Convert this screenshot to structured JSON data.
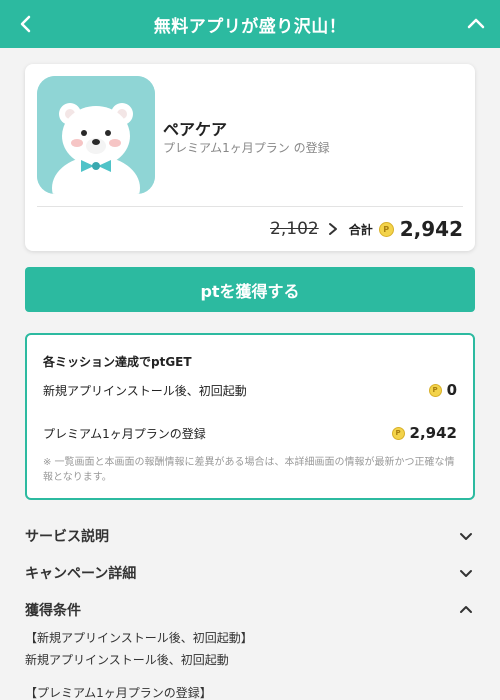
{
  "header": {
    "title": "無料アプリが盛り沢山！"
  },
  "app": {
    "name": "ペアケア",
    "description": "プレミアム1ヶ月プラン の登録",
    "old_price": "2,102",
    "total_label": "合計",
    "total_value": "2,942",
    "coin_symbol": "P"
  },
  "get_button": {
    "label": "ptを獲得する"
  },
  "missions": {
    "title": "各ミッション達成でptGET",
    "items": [
      {
        "label": "新規アプリインストール後、初回起動",
        "points": "0"
      },
      {
        "label": "プレミアム1ヶ月プランの登録",
        "points": "2,942"
      }
    ],
    "note": "※ 一覧画面と本画面の報酬情報に差異がある場合は、本詳細画面の情報が最新かつ正確な情報となります。"
  },
  "sections": {
    "service": "サービス説明",
    "campaign": "キャンペーン詳細",
    "conditions": "獲得条件"
  },
  "conditions_text": {
    "line1": "【新規アプリインストール後、初回起動】",
    "line2": "新規アプリインストール後、初回起動",
    "line3": "【プレミアム1ヶ月プランの登録】"
  },
  "colors": {
    "accent": "#2cbaa0",
    "coin": "#f3d34a"
  },
  "icons": {
    "back": "chevron-left-icon",
    "collapse": "chevron-up-icon",
    "expand": "chevron-down-icon",
    "coin": "point-coin-icon"
  }
}
